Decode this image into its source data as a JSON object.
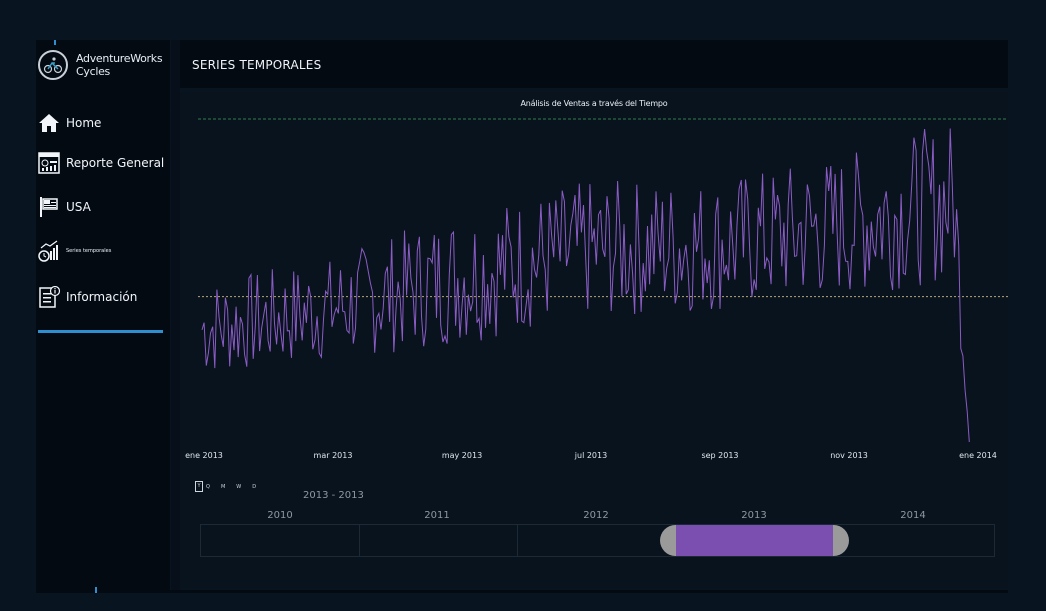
{
  "brand": {
    "line1": "AdventureWorks",
    "line2": "Cycles"
  },
  "nav": [
    {
      "label": "Home",
      "icon": "home-icon"
    },
    {
      "label": "Reporte General",
      "icon": "dashboard-icon"
    },
    {
      "label": "USA",
      "icon": "flag-icon"
    },
    {
      "label": "Series temporales",
      "icon": "timeseries-icon"
    },
    {
      "label": "Información",
      "icon": "info-document-icon"
    }
  ],
  "header": {
    "title": "SERIES TEMPORALES"
  },
  "chart": {
    "title": "Análisis de Ventas a través del Tiempo",
    "x_ticks": [
      "ene 2013",
      "mar 2013",
      "may 2013",
      "jul 2013",
      "sep 2013",
      "nov 2013",
      "ene 2014"
    ],
    "line_color": "#8a5cc4",
    "max_line_color": "#2e7d4a",
    "avg_line_color": "#b8a878"
  },
  "chart_data": {
    "type": "line",
    "title": "Análisis de Ventas a través del Tiempo",
    "xlabel": "",
    "ylabel": "",
    "x_range": [
      "2013-01-01",
      "2014-01-01"
    ],
    "x_ticks": [
      "ene 2013",
      "mar 2013",
      "may 2013",
      "jul 2013",
      "sep 2013",
      "nov 2013",
      "ene 2014"
    ],
    "reference_lines": [
      "max",
      "average"
    ],
    "daily_profile": [
      {
        "date": "2013-01-01",
        "low": 0.2,
        "high": 0.5
      },
      {
        "date": "2013-03-01",
        "low": 0.25,
        "high": 0.57
      },
      {
        "date": "2013-05-01",
        "low": 0.3,
        "high": 0.72
      },
      {
        "date": "2013-07-01",
        "low": 0.38,
        "high": 0.81
      },
      {
        "date": "2013-09-01",
        "low": 0.4,
        "high": 0.82
      },
      {
        "date": "2013-11-01",
        "low": 0.45,
        "high": 0.9
      },
      {
        "date": "2013-12-20",
        "low": 0.5,
        "high": 1.0
      },
      {
        "date": "2013-12-27",
        "low": 0.0,
        "high": 0.0
      }
    ],
    "grid": false
  },
  "time_controls": {
    "levels": [
      "Y",
      "Q",
      "M",
      "W",
      "D"
    ],
    "period_label": "2013 - 2013"
  },
  "slicer": {
    "years": [
      "2010",
      "2011",
      "2012",
      "2013",
      "2014"
    ],
    "selected": "2013",
    "selection_color": "#7a4fb0"
  }
}
